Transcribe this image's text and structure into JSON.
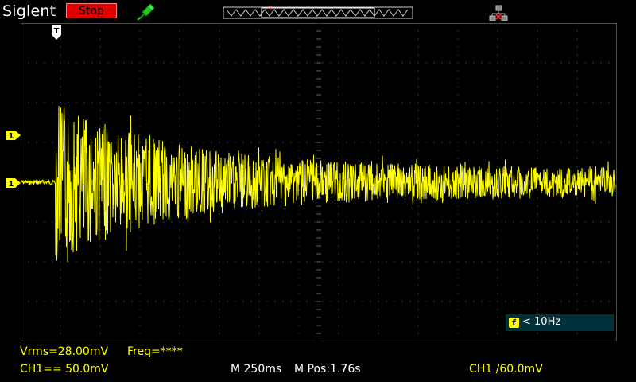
{
  "header": {
    "brand": "Siglent",
    "run_state": "Stop",
    "probe_icon": "probe-icon",
    "network_icon": "network-icon"
  },
  "trigger": {
    "top_marker": "T",
    "ch_marker": "1"
  },
  "frequency_box": {
    "icon_label": "f",
    "text": "< 10Hz"
  },
  "measurements": {
    "vrms": "Vrms=28.00mV",
    "freq": "Freq=****"
  },
  "status": {
    "ch1_scale": "CH1== 50.0mV",
    "timebase": "M 250ms",
    "mpos": "M Pos:1.76s",
    "trigger_level": "CH1 /60.0mV"
  },
  "colors": {
    "trace": "#ffff00",
    "grid": "#666666",
    "stop_bg": "#e00000"
  }
}
